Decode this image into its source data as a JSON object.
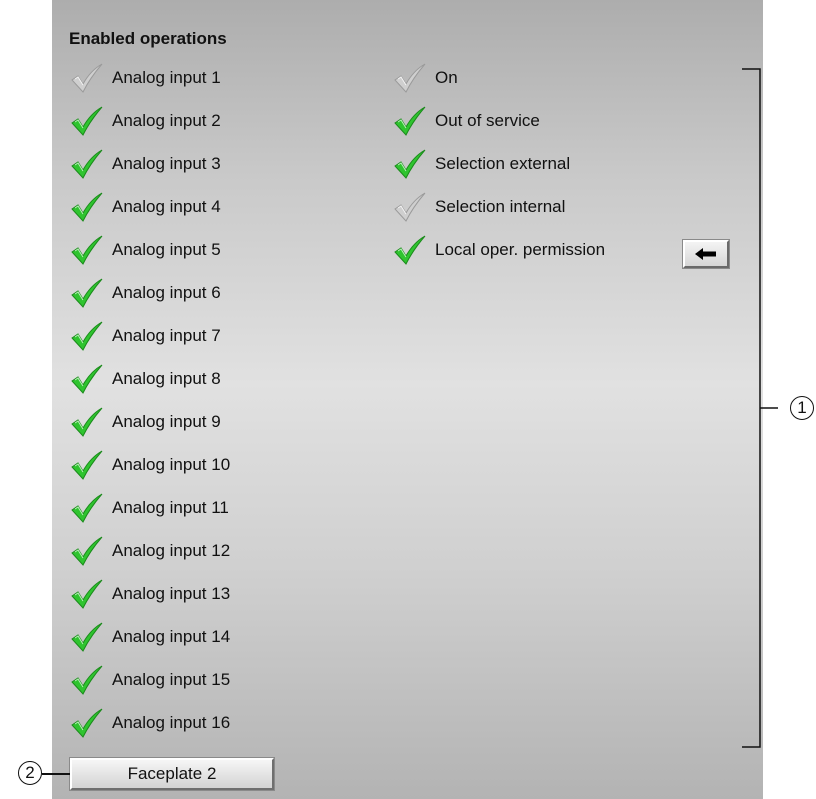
{
  "section_title": "Enabled operations",
  "left_operations": [
    {
      "label": "Analog input 1",
      "enabled": false
    },
    {
      "label": "Analog input 2",
      "enabled": true
    },
    {
      "label": "Analog input 3",
      "enabled": true
    },
    {
      "label": "Analog input 4",
      "enabled": true
    },
    {
      "label": "Analog input 5",
      "enabled": true
    },
    {
      "label": "Analog input 6",
      "enabled": true
    },
    {
      "label": "Analog input 7",
      "enabled": true
    },
    {
      "label": "Analog input 8",
      "enabled": true
    },
    {
      "label": "Analog input 9",
      "enabled": true
    },
    {
      "label": "Analog input 10",
      "enabled": true
    },
    {
      "label": "Analog input 11",
      "enabled": true
    },
    {
      "label": "Analog input 12",
      "enabled": true
    },
    {
      "label": "Analog input 13",
      "enabled": true
    },
    {
      "label": "Analog input 14",
      "enabled": true
    },
    {
      "label": "Analog input 15",
      "enabled": true
    },
    {
      "label": "Analog input 16",
      "enabled": true
    }
  ],
  "right_operations": [
    {
      "label": "On",
      "enabled": false
    },
    {
      "label": "Out of service",
      "enabled": true
    },
    {
      "label": "Selection external",
      "enabled": true
    },
    {
      "label": "Selection internal",
      "enabled": false
    },
    {
      "label": "Local oper. permission",
      "enabled": true
    }
  ],
  "local_permission_button": {
    "icon": "arrow-left-icon"
  },
  "faceplate_button": {
    "label": "Faceplate 2"
  },
  "callouts": {
    "one": "1",
    "two": "2"
  },
  "colors": {
    "check_enabled": "#2fc42f",
    "check_disabled": "#cfcfcf",
    "panel_gray": "#c9c9c9"
  }
}
